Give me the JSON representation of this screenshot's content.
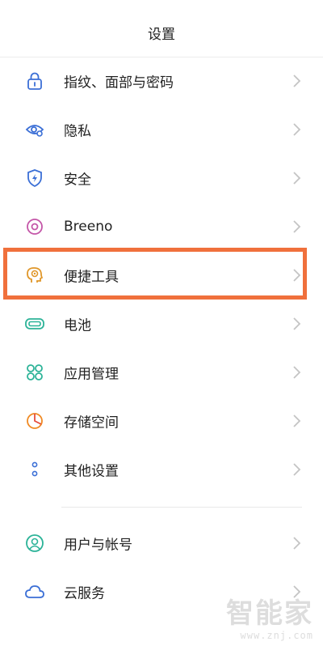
{
  "header": {
    "title": "设置"
  },
  "items": [
    {
      "label": "指纹、面部与密码",
      "icon": "lock-icon"
    },
    {
      "label": "隐私",
      "icon": "privacy-eye-icon"
    },
    {
      "label": "安全",
      "icon": "shield-icon"
    },
    {
      "label": "Breeno",
      "icon": "breeno-icon"
    },
    {
      "label": "便捷工具",
      "icon": "head-tools-icon"
    },
    {
      "label": "电池",
      "icon": "battery-icon"
    },
    {
      "label": "应用管理",
      "icon": "apps-grid-icon"
    },
    {
      "label": "存储空间",
      "icon": "storage-pie-icon"
    },
    {
      "label": "其他设置",
      "icon": "more-dots-icon"
    },
    {
      "label": "用户与帐号",
      "icon": "user-icon"
    },
    {
      "label": "云服务",
      "icon": "cloud-icon"
    }
  ],
  "highlight_color": "#f0703c",
  "watermark": {
    "brand": "智能家",
    "url": "www.znj.com"
  }
}
